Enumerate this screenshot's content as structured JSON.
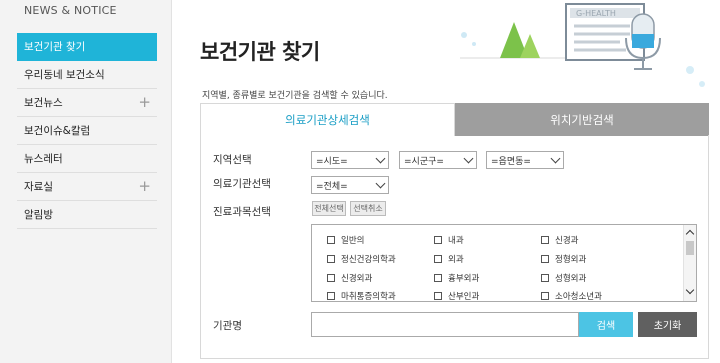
{
  "sidebar": {
    "title": "NEWS & NOTICE",
    "items": [
      {
        "label": "보건기관 찾기",
        "active": true,
        "expandable": false
      },
      {
        "label": "우리동네 보건소식",
        "active": false,
        "expandable": false
      },
      {
        "label": "보건뉴스",
        "active": false,
        "expandable": true
      },
      {
        "label": "보건이슈&칼럼",
        "active": false,
        "expandable": false
      },
      {
        "label": "뉴스레터",
        "active": false,
        "expandable": false
      },
      {
        "label": "자료실",
        "active": false,
        "expandable": true
      },
      {
        "label": "알림방",
        "active": false,
        "expandable": false
      }
    ],
    "plus_icon": "+"
  },
  "header": {
    "title": "보건기관 찾기",
    "description": "지역별, 종류별로 보건기관을 검색할 수 있습니다.",
    "illustration_text": "G-HEALTH"
  },
  "tabs": [
    {
      "label": "의료기관상세검색",
      "active": true
    },
    {
      "label": "위치기반검색",
      "active": false
    }
  ],
  "form": {
    "region_label": "지역선택",
    "sido": "=시도=",
    "sigungu": "=시군구=",
    "eupmyeondong": "=읍면동=",
    "institution_label": "의료기관선택",
    "institution": "=전체=",
    "department_label": "진료과목선택",
    "select_all": "전체선택",
    "deselect": "선택취소",
    "departments": [
      "일반의",
      "내과",
      "신경과",
      "정신건강의학과",
      "외과",
      "정형외과",
      "신경외과",
      "흉부외과",
      "성형외과",
      "마취통증의학과",
      "산부인과",
      "소아청소년과"
    ],
    "name_label": "기관명",
    "name_value": "",
    "search_button": "검색",
    "reset_button": "초기화"
  },
  "colors": {
    "accent": "#1fb4d8",
    "tab_inactive": "#9e9e9e",
    "search_button": "#4cc4e4",
    "reset_button": "#606060"
  }
}
